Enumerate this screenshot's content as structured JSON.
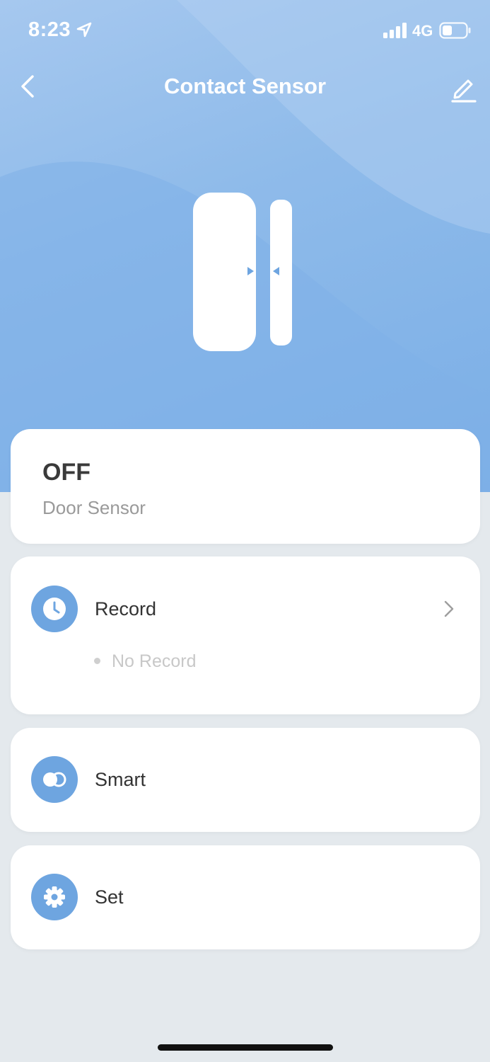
{
  "status_bar": {
    "time": "8:23",
    "network": "4G",
    "icons": [
      "location-arrow-icon",
      "signal-icon",
      "battery-icon"
    ]
  },
  "header": {
    "title": "Contact Sensor",
    "back_icon": "chevron-left-icon",
    "edit_icon": "pencil-icon"
  },
  "device": {
    "illustration": "door-contact-sensor-icon",
    "state": "OFF",
    "type": "Door Sensor"
  },
  "menu": {
    "record": {
      "label": "Record",
      "icon": "clock-icon",
      "empty_text": "No Record"
    },
    "smart": {
      "label": "Smart",
      "icon": "toggle-icon"
    },
    "set": {
      "label": "Set",
      "icon": "gear-icon"
    }
  },
  "colors": {
    "header_gradient_top": "#a6c8ef",
    "header_gradient_bottom": "#7aaee6",
    "icon_accent": "#6ea5e0",
    "page_background": "#e4e9ed",
    "card_background": "#ffffff"
  }
}
